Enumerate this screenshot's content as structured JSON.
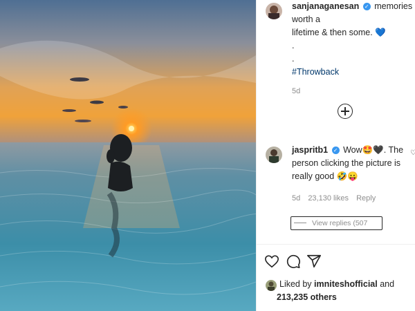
{
  "post": {
    "author": "sanjanaganesan",
    "caption_line1": "memories worth a",
    "caption_line2": "lifetime & then some.",
    "caption_emoji": "💙",
    "dot1": ".",
    "dot2": ".",
    "hashtag": "#Throwback",
    "age": "5d"
  },
  "comment": {
    "author": "jaspritb1",
    "text_part1": "Wow",
    "emoji1": "🤩🖤",
    "text_part2": ". The person clicking the picture is really good",
    "emoji2": "🤣😛",
    "age": "5d",
    "likes": "23,130 likes",
    "reply_label": "Reply",
    "view_replies": "View replies (507"
  },
  "likes": {
    "prefix": "Liked by",
    "user": "imniteshofficial",
    "mid": "and",
    "count": "213,235 others"
  },
  "icons": {
    "add": "add-circle-icon",
    "like": "heart-icon",
    "comment": "comment-icon",
    "share": "share-icon",
    "verified": "verified-badge-icon"
  },
  "colors": {
    "verified_blue": "#3897f0",
    "hashtag": "#00376b",
    "muted": "#8e8e8e"
  }
}
